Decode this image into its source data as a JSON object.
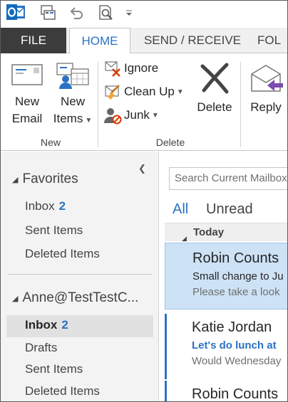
{
  "colors": {
    "accent": "#2a72c3",
    "selected_bg": "#cde2f5",
    "file_tab_bg": "#3c3c3c"
  },
  "quick_access": {
    "icons": [
      "outlook-app-icon",
      "send-receive-icon",
      "undo-icon",
      "print-preview-icon",
      "customize-dropdown-icon"
    ]
  },
  "tabs": [
    {
      "label": "FILE"
    },
    {
      "label": "HOME"
    },
    {
      "label": "SEND / RECEIVE"
    },
    {
      "label": "FOL"
    }
  ],
  "ribbon": {
    "new_email": {
      "line1": "New",
      "line2": "Email"
    },
    "new_items": {
      "line1": "New",
      "line2": "Items"
    },
    "ignore": "Ignore",
    "clean_up": "Clean Up",
    "junk": "Junk",
    "delete": "Delete",
    "reply": "Reply",
    "groups": {
      "new": "New",
      "delete": "Delete"
    }
  },
  "nav": {
    "favorites_label": "Favorites",
    "favorites": [
      {
        "label": "Inbox",
        "count": "2"
      },
      {
        "label": "Sent Items"
      },
      {
        "label": "Deleted Items"
      }
    ],
    "account_label": "Anne@TestTestC...",
    "account": [
      {
        "label": "Inbox",
        "count": "2"
      },
      {
        "label": "Drafts"
      },
      {
        "label": "Sent Items"
      },
      {
        "label": "Deleted Items"
      }
    ]
  },
  "list": {
    "search_placeholder": "Search Current Mailbox",
    "filter_all": "All",
    "filter_unread": "Unread",
    "group": "Today",
    "messages": [
      {
        "sender": "Robin Counts",
        "subject": "Small change to Ju",
        "preview": "Please take a look"
      },
      {
        "sender": "Katie Jordan",
        "subject": "Let's do lunch at",
        "preview": "Would Wednesday"
      },
      {
        "sender": "Robin Counts"
      }
    ]
  }
}
